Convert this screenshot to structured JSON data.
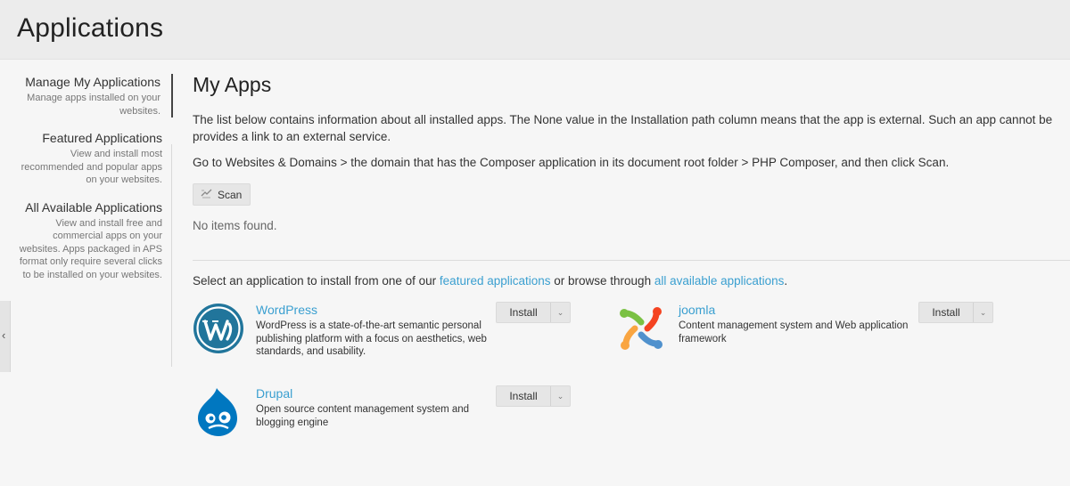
{
  "header": {
    "title": "Applications"
  },
  "sidebar": {
    "collapse_glyph": "‹",
    "items": [
      {
        "title": "Manage My Applications",
        "desc": "Manage apps installed on your websites."
      },
      {
        "title": "Featured Applications",
        "desc": "View and install most recommended and popular apps on your websites."
      },
      {
        "title": "All Available Applications",
        "desc": "View and install free and commercial apps on your websites. Apps packaged in APS format only require several clicks to be installed on your websites."
      }
    ]
  },
  "main": {
    "title": "My Apps",
    "intro_line1": "The list below contains information about all installed apps. The None value in the Installation path column means that the app is external. Such an app cannot be",
    "intro_line2": "provides a link to an external service.",
    "hint": "Go to Websites & Domains > the domain that has the Composer application in its document root folder > PHP Composer, and then click Scan.",
    "scan_label": "Scan",
    "empty_text": "No items found.",
    "select_prefix": "Select an application to install from one of our ",
    "featured_link": "featured applications",
    "select_middle": " or browse through ",
    "all_link": "all available applications",
    "select_suffix": "."
  },
  "apps": [
    {
      "name": "WordPress",
      "desc": "WordPress is a state-of-the-art semantic personal publishing platform with a focus on aesthetics, web standards, and usability.",
      "install_label": "Install"
    },
    {
      "name": "joomla",
      "desc": "Content management system and Web application framework",
      "install_label": "Install"
    },
    {
      "name": "Drupal",
      "desc": "Open source content management system and blogging engine",
      "install_label": "Install"
    }
  ],
  "colors": {
    "link": "#3a9fd0",
    "wordpress": "#21759b",
    "drupal": "#0077c0"
  }
}
